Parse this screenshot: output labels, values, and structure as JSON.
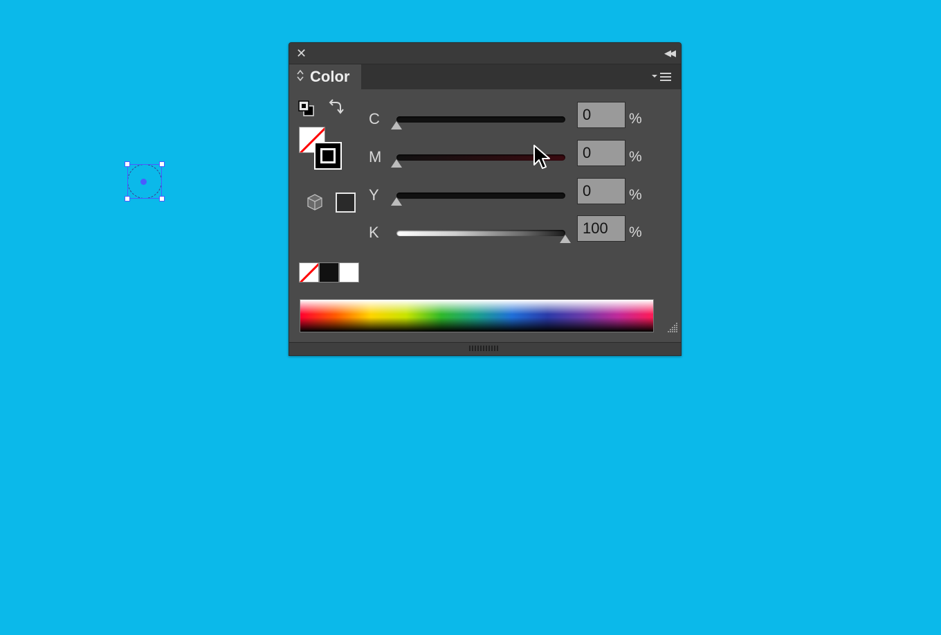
{
  "panel": {
    "title": "Color",
    "close_glyph": "✕",
    "collapse_glyph": "◀◀",
    "tab_arrows_glyph": "⌃⌄"
  },
  "icons": {
    "swap_fill_stroke": "swap-arrow-icon",
    "default_fill_stroke": "default-fill-stroke-icon",
    "out_of_gamut": "cube-icon",
    "menu": "panel-menu-icon"
  },
  "fill": {
    "state": "none"
  },
  "stroke": {
    "color": "#000000"
  },
  "channels": [
    {
      "label": "C",
      "value": "0",
      "unit": "%",
      "fraction": 0
    },
    {
      "label": "M",
      "value": "0",
      "unit": "%",
      "fraction": 0
    },
    {
      "label": "Y",
      "value": "0",
      "unit": "%",
      "fraction": 0
    },
    {
      "label": "K",
      "value": "100",
      "unit": "%",
      "fraction": 1
    }
  ],
  "quick_swatches": [
    {
      "name": "none",
      "color": "#ffffff"
    },
    {
      "name": "black",
      "color": "#111111"
    },
    {
      "name": "white",
      "color": "#ffffff"
    }
  ],
  "colors": {
    "canvas_background": "#0bb9ea",
    "panel_background": "#4a4a4a",
    "selection": "#4a5cff"
  }
}
